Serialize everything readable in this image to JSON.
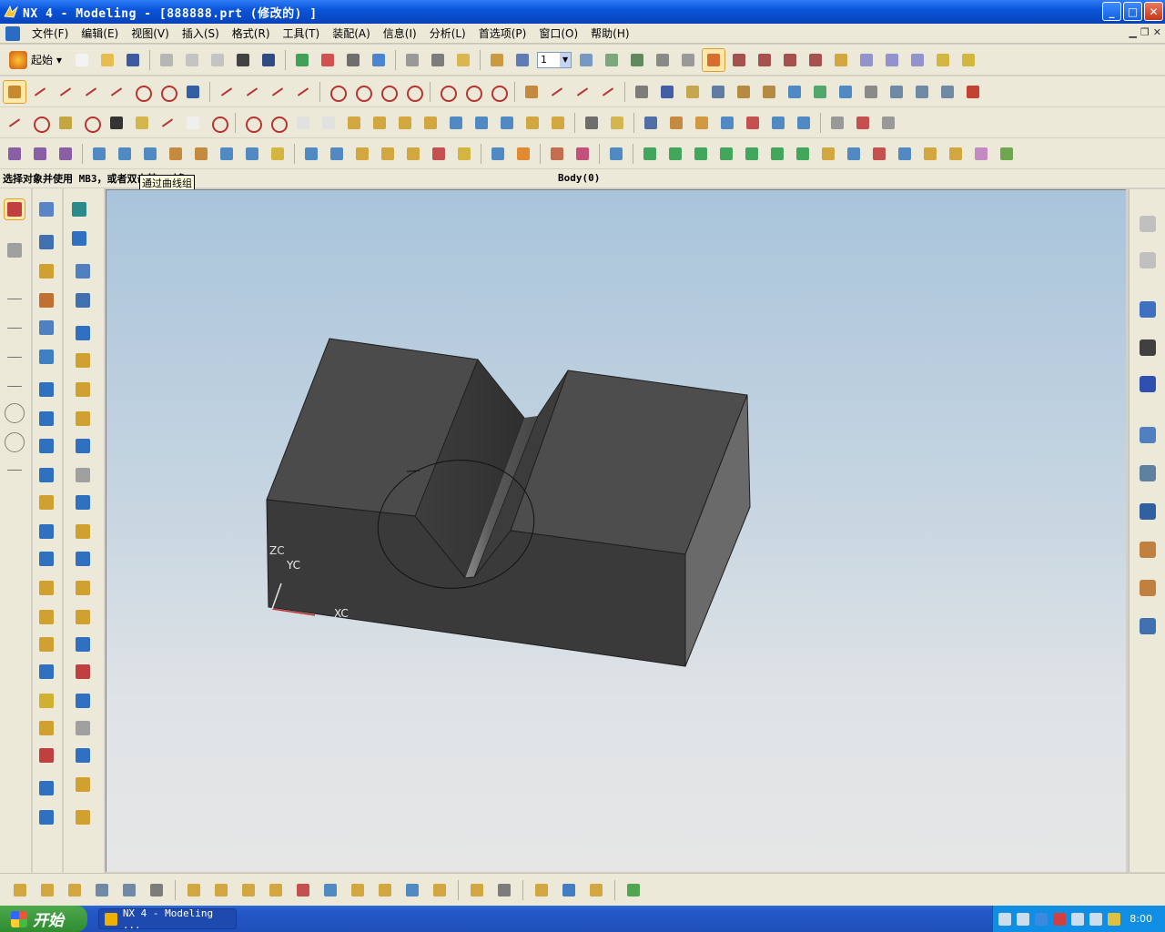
{
  "window": {
    "title": "NX 4 - Modeling - [888888.prt  (修改的) ]",
    "buttons": {
      "minimize": "_",
      "maximize": "□",
      "close": "✕"
    }
  },
  "menubar": {
    "items": [
      "文件(F)",
      "编辑(E)",
      "视图(V)",
      "插入(S)",
      "格式(R)",
      "工具(T)",
      "装配(A)",
      "信息(I)",
      "分析(L)",
      "首选项(P)",
      "窗口(O)",
      "帮助(H)"
    ]
  },
  "toolbar": {
    "start_label": "起始",
    "layer_value": "1"
  },
  "status": {
    "prompt": "选择对象并使用 MB3，或者双击某一对象",
    "selection": "Body(0)"
  },
  "tooltip": "通过曲线组",
  "viewport": {
    "axis_labels": {
      "zc": "ZC",
      "yc": "YC",
      "xc": "XC"
    }
  },
  "taskbar": {
    "start": "开始",
    "task_item": "NX 4 - Modeling ...",
    "clock": "8:00"
  },
  "colors": {
    "title_bar": "#0a55d9",
    "model_face": "#4a4a4a",
    "viewport_top": "#a9c4db",
    "viewport_bottom": "#e6e6e6"
  }
}
